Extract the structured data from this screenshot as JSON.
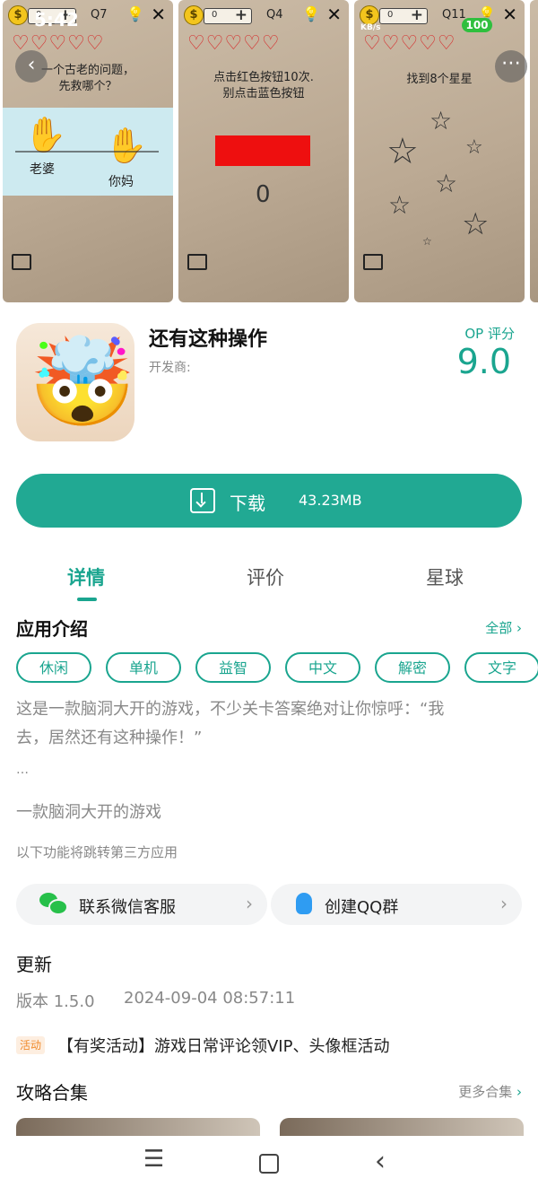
{
  "status": {
    "time": "5:42",
    "battery": "100",
    "net_speed": "KB/s"
  },
  "screenshots": [
    {
      "q": "Q7",
      "coins": "0",
      "question": "一个古老的问题，\n先救哪个？",
      "labels": [
        "老婆",
        "你妈"
      ]
    },
    {
      "q": "Q4",
      "coins": "0",
      "question": "点击红色按钮10次.\n别点击蓝色按钮",
      "counter": "0"
    },
    {
      "q": "Q11",
      "coins": "0",
      "question": "找到8个星星"
    }
  ],
  "app": {
    "name": "还有这种操作",
    "developer_label": "开发商:",
    "score_label": "OP 评分",
    "score": "9.0"
  },
  "download": {
    "label": "下载",
    "size": "43.23MB"
  },
  "tabs": [
    "详情",
    "评价",
    "星球"
  ],
  "intro": {
    "title": "应用介绍",
    "all_label": "全部",
    "tags": [
      "休闲",
      "单机",
      "益智",
      "中文",
      "解密",
      "文字"
    ],
    "description_line1": "这是一款脑洞大开的游戏，不少关卡答案绝对让你惊呼：“我",
    "description_line2": "去，居然还有这种操作！”",
    "ellipsis": "…",
    "summary": "一款脑洞大开的游戏",
    "third_party_note": "以下功能将跳转第三方应用"
  },
  "links": [
    {
      "label": "联系微信客服",
      "icon": "wechat-icon"
    },
    {
      "label": "创建QQ群",
      "icon": "qq-icon"
    }
  ],
  "update": {
    "title": "更新",
    "version": "版本 1.5.0",
    "date": "2024-09-04 08:57:11",
    "badge": "活动",
    "activity": "【有奖活动】游戏日常评论领VIP、头像框活动"
  },
  "guides": {
    "title": "攻略合集",
    "more_label": "更多合集"
  },
  "colors": {
    "accent": "#1aa58f",
    "button": "#21a993"
  }
}
